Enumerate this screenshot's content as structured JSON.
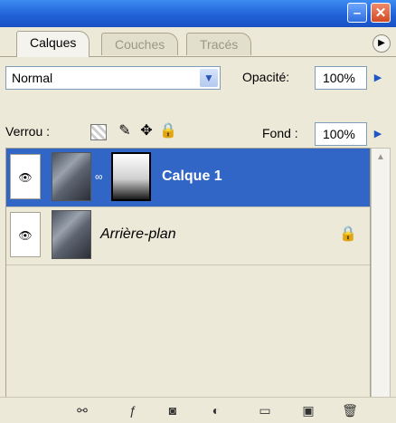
{
  "tabs": [
    {
      "label": "Calques",
      "active": true
    },
    {
      "label": "Couches",
      "active": false
    },
    {
      "label": "Tracés",
      "active": false
    }
  ],
  "blend_mode": {
    "value": "Normal"
  },
  "opacity": {
    "label": "Opacité:",
    "value": "100%"
  },
  "lock": {
    "label": "Verrou :",
    "icons": [
      "lock-transparent-icon",
      "lock-image-icon",
      "lock-position-icon",
      "lock-all-icon"
    ]
  },
  "fill": {
    "label": "Fond :",
    "value": "100%"
  },
  "layers": [
    {
      "name": "Calque 1",
      "selected": true,
      "visible": true,
      "has_mask": true
    },
    {
      "name": "Arrière-plan",
      "selected": false,
      "visible": true,
      "locked": true
    }
  ],
  "bottom_icons": [
    "link-layers-icon",
    "layer-style-icon",
    "add-mask-icon",
    "adjustment-layer-icon",
    "new-group-icon",
    "new-layer-icon",
    "delete-layer-icon"
  ],
  "colors": {
    "selection": "#3165c6",
    "panel": "#ece9d8",
    "titlebar": "#1f5fd6"
  }
}
